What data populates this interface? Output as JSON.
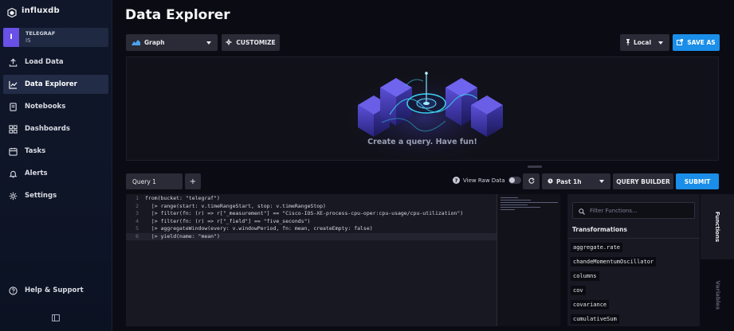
{
  "brand": {
    "name": "influxdb"
  },
  "org": {
    "initial": "I",
    "label": "TELEGRAF",
    "name": "IS"
  },
  "nav": [
    {
      "label": "Load Data",
      "icon": "upload-icon"
    },
    {
      "label": "Data Explorer",
      "icon": "chart-line-icon",
      "active": true
    },
    {
      "label": "Notebooks",
      "icon": "notebook-icon"
    },
    {
      "label": "Dashboards",
      "icon": "dashboard-icon"
    },
    {
      "label": "Tasks",
      "icon": "calendar-icon"
    },
    {
      "label": "Alerts",
      "icon": "bell-icon"
    },
    {
      "label": "Settings",
      "icon": "gear-icon"
    }
  ],
  "help": {
    "label": "Help & Support"
  },
  "header": {
    "title": "Data Explorer",
    "vis_type": "Graph",
    "customize": "CUSTOMIZE",
    "timezone": "Local",
    "save_as": "SAVE AS"
  },
  "viz": {
    "empty_hint": "Create a query. Have fun!"
  },
  "query": {
    "tab": "Query 1",
    "add": "+",
    "raw_toggle": "View Raw Data",
    "range": "Past 1h",
    "builder": "QUERY BUILDER",
    "submit": "SUBMIT"
  },
  "editor": {
    "lines": [
      {
        "num": "1",
        "code": "from(bucket: \"telegraf\")"
      },
      {
        "num": "2",
        "code": "  |> range(start: v.timeRangeStart, stop: v.timeRangeStop)"
      },
      {
        "num": "3",
        "code": "  |> filter(fn: (r) => r[\"_measurement\"] == \"Cisco-IOS-XE-process-cpu-oper:cpu-usage/cpu-utilization\")"
      },
      {
        "num": "4",
        "code": "  |> filter(fn: (r) => r[\"_field\"] == \"five_seconds\")"
      },
      {
        "num": "5",
        "code": "  |> aggregateWindow(every: v.windowPeriod, fn: mean, createEmpty: false)"
      },
      {
        "num": "6",
        "code": "  |> yield(name: \"mean\")"
      }
    ]
  },
  "functions": {
    "placeholder": "Filter Functions...",
    "section": "Transformations",
    "items": [
      "aggregate.rate",
      "chandeMomentumOscillator",
      "columns",
      "cov",
      "covariance",
      "cumulativeSum"
    ]
  },
  "side_tabs": {
    "functions": "Functions",
    "variables": "Variables"
  },
  "colors": {
    "accent_blue": "#1a8ee8",
    "purple": "#6950e6",
    "sidebar": "#10172a"
  }
}
